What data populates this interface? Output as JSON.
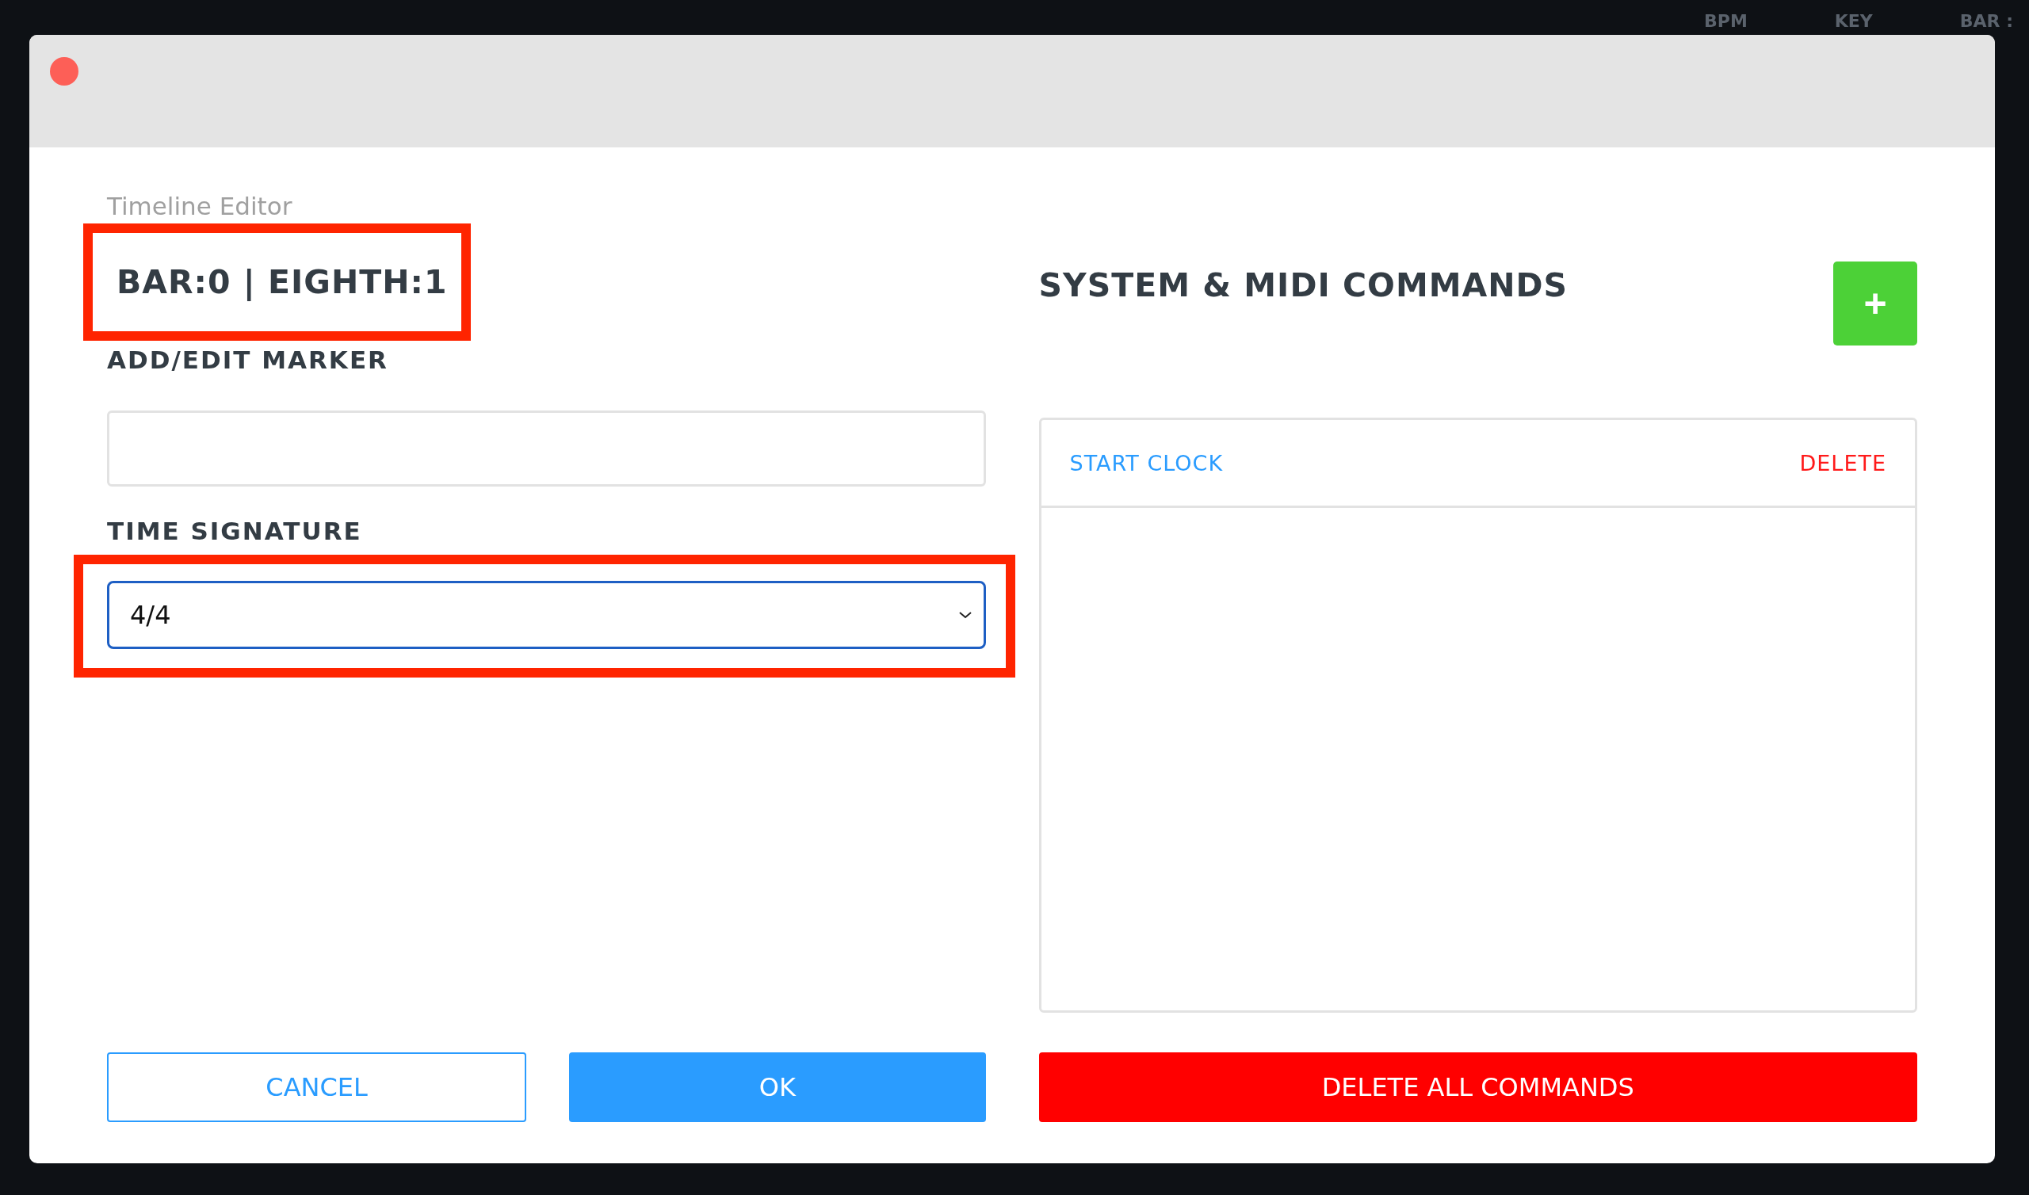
{
  "background": {
    "top_labels": [
      "BPM",
      "KEY",
      "BAR :"
    ]
  },
  "dialog": {
    "subtitle": "Timeline Editor",
    "position": "BAR:0 | EIGHTH:1",
    "position_highlighted": true,
    "marker": {
      "label": "ADD/EDIT MARKER"
    },
    "time_signature": {
      "label": "TIME SIGNATURE",
      "value": "4/4",
      "highlighted": true
    },
    "commands": {
      "title": "SYSTEM & MIDI COMMANDS",
      "add_button": "+",
      "items": [
        {
          "name": "START CLOCK",
          "action": "DELETE"
        }
      ]
    },
    "buttons": {
      "cancel": "CANCEL",
      "ok": "OK",
      "delete_all": "DELETE ALL COMMANDS"
    }
  }
}
